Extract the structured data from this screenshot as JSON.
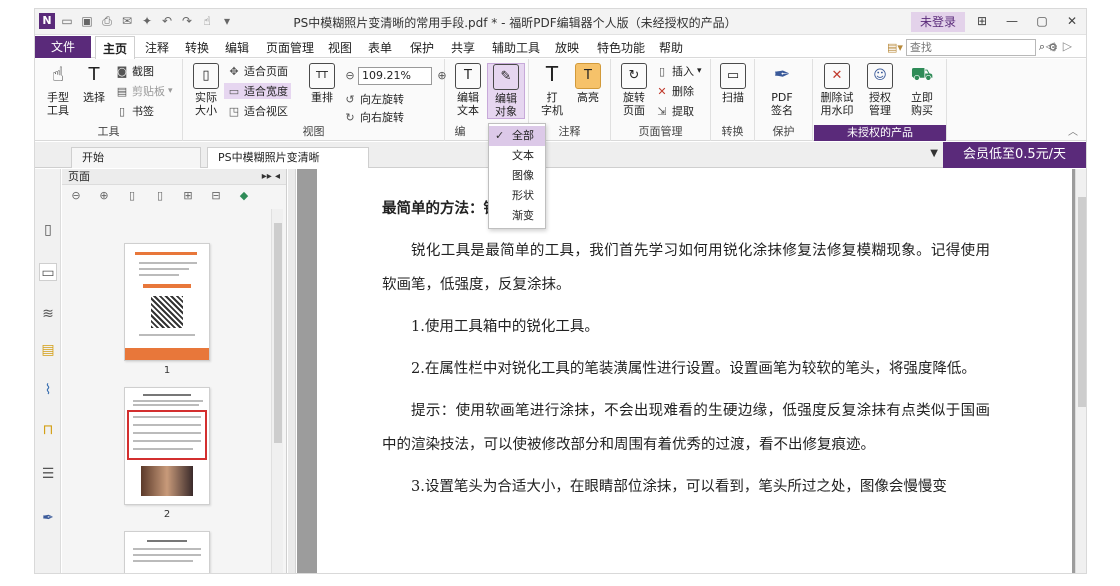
{
  "window": {
    "title": "PS中模糊照片变清晰的常用手段.pdf * - 福昕PDF编辑器个人版（未经授权的产品）",
    "login": "未登录"
  },
  "menu": {
    "file": "文件",
    "items": [
      "主页",
      "注释",
      "转换",
      "编辑",
      "页面管理",
      "视图",
      "表单",
      "保护",
      "共享",
      "辅助工具",
      "放映",
      "特色功能",
      "帮助"
    ],
    "search_placeholder": "查找"
  },
  "ribbon": {
    "tools": {
      "hand": "手型\n工具",
      "select": "选择",
      "screenshot": "截图",
      "clipboard": "剪贴板",
      "bookmark": "书签",
      "group": "工具"
    },
    "view": {
      "actual": "实际\n大小",
      "fit_page": "适合页面",
      "fit_width": "适合宽度",
      "fit_visible": "适合视区",
      "reflow": "重排",
      "zoom": "109.21%",
      "rotate_left": "向左旋转",
      "rotate_right": "向右旋转",
      "group": "视图"
    },
    "edit": {
      "edit_text": "编辑\n文本",
      "edit_object": "编辑\n对象",
      "group": "编"
    },
    "comment": {
      "typewriter": "打\n字机",
      "highlight": "高亮",
      "group": "注释"
    },
    "page_mgmt": {
      "rotate_page": "旋转\n页面",
      "insert": "插入",
      "delete": "删除",
      "extract": "提取",
      "group": "页面管理"
    },
    "convert": {
      "scan": "扫描",
      "group": "转换"
    },
    "protect": {
      "pdf_sign": "PDF\n签名",
      "group": "保护"
    },
    "unlicensed": {
      "remove_watermark": "删除试\n用水印",
      "license_mgmt": "授权\n管理",
      "buy": "立即\n购买",
      "group": "未授权的产品"
    }
  },
  "dropdown": {
    "items": [
      "全部",
      "文本",
      "图像",
      "形状",
      "渐变"
    ],
    "selected": "全部"
  },
  "tabs": {
    "start": "开始",
    "doc": "PS中模糊照片变清晰的..."
  },
  "promo": "会员低至0.5元/天",
  "panel": {
    "title": "页面",
    "pages": [
      "1",
      "2"
    ]
  },
  "doc": {
    "heading": "最简单的方法：锐化工具",
    "paragraphs": [
      "锐化工具是最简单的工具，我们首先学习如何用锐化涂抹修复法修复模糊现象。记得使用软画笔，低强度，反复涂抹。",
      "1.使用工具箱中的锐化工具。",
      "2.在属性栏中对锐化工具的笔装潢属性进行设置。设置画笔为较软的笔头，将强度降低。",
      "提示：使用软画笔进行涂抹，不会出现难看的生硬边缘，低强度反复涂抹有点类似于国画中的渲染技法，可以使被修改部分和周围有着优秀的过渡，看不出修复痕迹。",
      "3.设置笔头为合适大小，在眼睛部位涂抹，可以看到，笔头所过之处，图像会慢慢变"
    ]
  }
}
